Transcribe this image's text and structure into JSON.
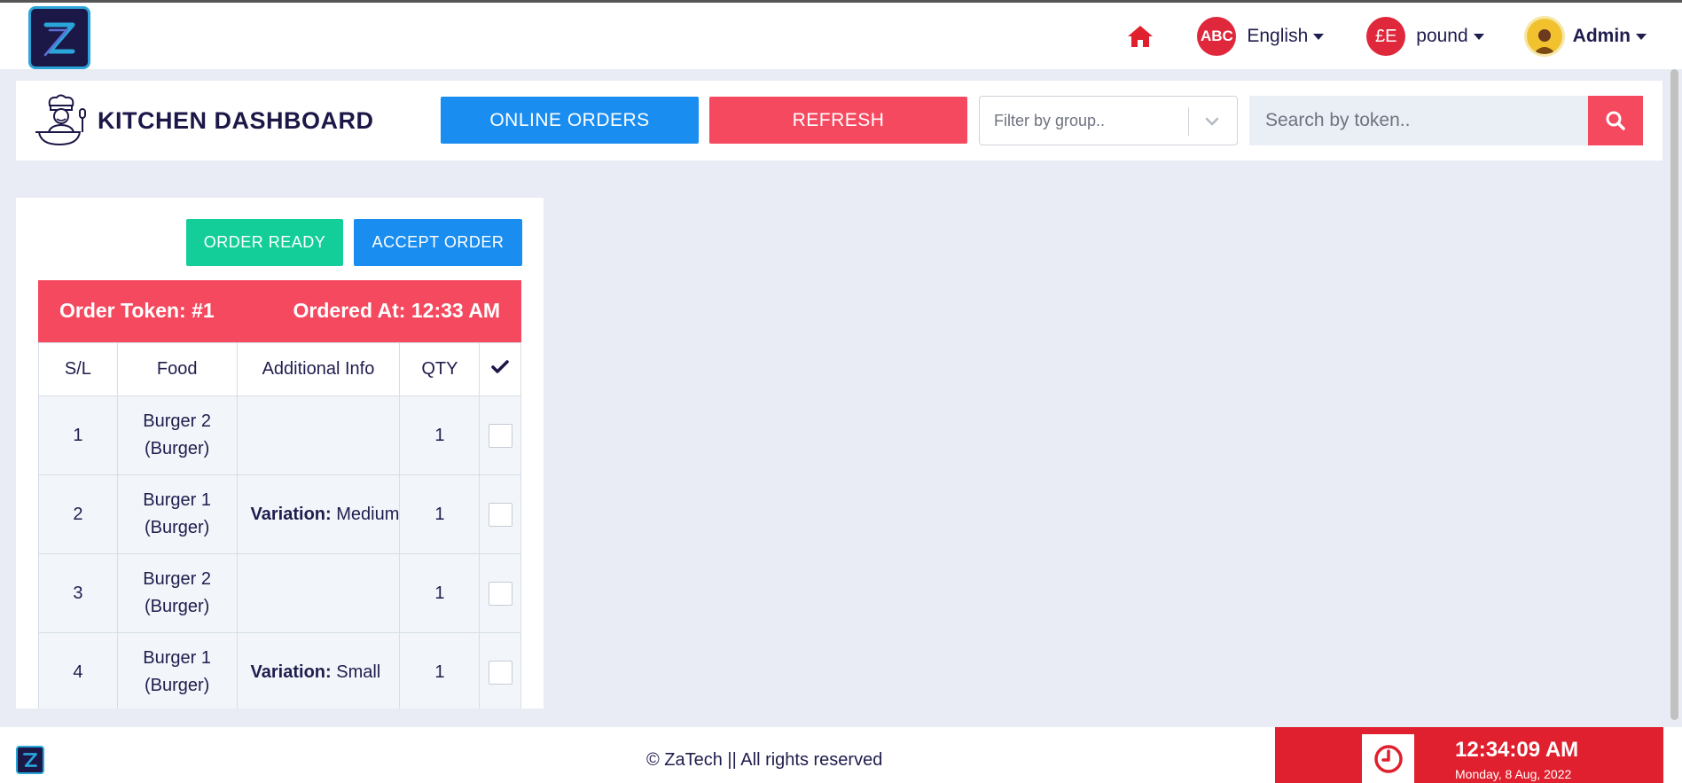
{
  "topnav": {
    "language": {
      "badge": "ABC",
      "label": "English"
    },
    "currency": {
      "badge": "£E",
      "label": "pound"
    },
    "user": {
      "label": "Admin"
    }
  },
  "header": {
    "title": "KITCHEN DASHBOARD",
    "online_orders_label": "ONLINE ORDERS",
    "refresh_label": "REFRESH",
    "filter_placeholder": "Filter by group..",
    "search_placeholder": "Search by token.."
  },
  "order": {
    "ready_label": "ORDER READY",
    "accept_label": "ACCEPT ORDER",
    "token_label": "Order Token: #1",
    "ordered_at_label": "Ordered At: 12:33 AM",
    "columns": [
      "S/L",
      "Food",
      "Additional Info",
      "QTY"
    ],
    "rows": [
      {
        "sl": "1",
        "food_line1": "Burger 2",
        "food_line2": "(Burger)",
        "info_label": "",
        "info_value": "",
        "qty": "1",
        "checked": false
      },
      {
        "sl": "2",
        "food_line1": "Burger 1",
        "food_line2": "(Burger)",
        "info_label": "Variation:",
        "info_value": "Medium",
        "qty": "1",
        "checked": false
      },
      {
        "sl": "3",
        "food_line1": "Burger 2",
        "food_line2": "(Burger)",
        "info_label": "",
        "info_value": "",
        "qty": "1",
        "checked": false
      },
      {
        "sl": "4",
        "food_line1": "Burger 1",
        "food_line2": "(Burger)",
        "info_label": "Variation:",
        "info_value": "Small",
        "qty": "1",
        "checked": false
      }
    ]
  },
  "footer": {
    "copyright": "© ZaTech || All rights reserved",
    "time": "12:34:09 AM",
    "date": "Monday, 8 Aug, 2022"
  },
  "colors": {
    "accent_red": "#f5495f",
    "accent_blue": "#1a8df0",
    "accent_green": "#14ce9a",
    "clock_red": "#e0202e",
    "brand_navy": "#1b1747"
  },
  "icons": {
    "home": "home-icon",
    "search": "search-icon",
    "chevron": "chevron-down-icon",
    "check": "check-icon",
    "clock": "clock-icon",
    "chef": "chef-icon"
  }
}
